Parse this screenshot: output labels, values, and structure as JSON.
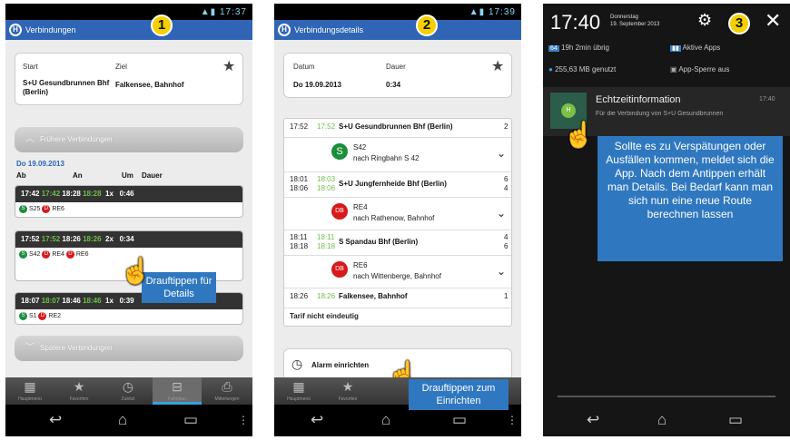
{
  "phone1": {
    "badge": "1",
    "status_time": "17:37",
    "app_title": "Verbindungen",
    "start_label": "Start",
    "start_value": "S+U Gesundbrunnen Bhf (Berlin)",
    "ziel_label": "Ziel",
    "ziel_value": "Falkensee, Bahnhof",
    "earlier_label": "Frühere Verbindungen",
    "date": "Do 19.09.2013",
    "col_ab": "Ab",
    "col_an": "An",
    "col_um": "Um",
    "col_dauer": "Dauer",
    "trips": [
      {
        "ab": "17:42",
        "ab_rt": "17:42",
        "an": "18:28",
        "an_rt": "18:28",
        "um": "1x",
        "dauer": "0:46",
        "lines": [
          "S25",
          "RE6"
        ]
      },
      {
        "ab": "17:52",
        "ab_rt": "17:52",
        "an": "18:26",
        "an_rt": "18:26",
        "um": "2x",
        "dauer": "0:34",
        "lines": [
          "S42",
          "RE4",
          "RE6"
        ]
      },
      {
        "ab": "18:07",
        "ab_rt": "18:07",
        "an": "18:46",
        "an_rt": "18:46",
        "um": "1x",
        "dauer": "0:39",
        "lines": [
          "S1",
          "RE2"
        ]
      }
    ],
    "later_label": "Spätere Verbindungen",
    "callout": "Drauftippen für Details",
    "tabs": [
      "Hauptmenü",
      "Favoriten",
      "Zuletzt",
      "Fahrplan",
      "Mitteilungen"
    ]
  },
  "phone2": {
    "badge": "2",
    "status_time": "17:39",
    "app_title": "Verbindungsdetails",
    "datum_label": "Datum",
    "datum_value": "Do 19.09.2013",
    "dauer_label": "Dauer",
    "dauer_value": "0:34",
    "stops": [
      {
        "time": "17:52",
        "rt": "17:52",
        "name": "S+U Gesundbrunnen Bhf (Berlin)",
        "track": "2"
      },
      {
        "line": "S42",
        "dir": "nach Ringbahn S 42"
      },
      {
        "time": "18:01",
        "time2": "18:06",
        "rt": "18:03",
        "rt2": "18:06",
        "name": "S+U Jungfernheide Bhf (Berlin)",
        "track": "6",
        "track2": "4"
      },
      {
        "line": "RE4",
        "dir": "nach Rathenow, Bahnhof"
      },
      {
        "time": "18:11",
        "time2": "18:18",
        "rt": "18:11",
        "rt2": "18:18",
        "name": "S Spandau Bhf (Berlin)",
        "track": "4",
        "track2": "6"
      },
      {
        "line": "RE6",
        "dir": "nach Wittenberge, Bahnhof"
      },
      {
        "time": "18:26",
        "rt": "18:26",
        "name": "Falkensee, Bahnhof",
        "track": "1"
      }
    ],
    "tarif": "Tarif nicht eindeutig",
    "alarm": "Alarm einrichten",
    "callout": "Drauftippen zum Einrichten",
    "tabs": [
      "Hauptmenü",
      "Favoriten",
      "Zuletzt",
      "Fahrplan",
      "Mitteilungen"
    ]
  },
  "phone3": {
    "badge": "3",
    "time": "17:40",
    "date_line1": "Donnerstag",
    "date_line2": "19. September 2013",
    "tiles": [
      "19h 2min übrig",
      "Aktive Apps",
      "255,63 MB genutzt",
      "App-Sperre aus"
    ],
    "notif_title": "Echtzeitinformation",
    "notif_time": "17:40",
    "notif_text": "Für die Verbindung von S+U Gesundbrunnen",
    "callout": "Sollte es zu Verspätungen oder Ausfällen kommen, meldet sich die App. Nach dem Antippen erhält man Details. Bei Bedarf kann man sich nun eine neue Route berechnen lassen"
  },
  "colors": {
    "accent": "#2f65b4",
    "badge": "#f4d000",
    "realtime": "#6fbf4a"
  }
}
